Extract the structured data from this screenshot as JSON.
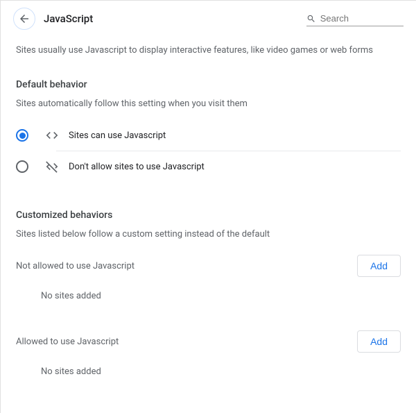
{
  "header": {
    "title": "JavaScript",
    "search_placeholder": "Search"
  },
  "intro": "Sites usually use Javascript to display interactive features, like video games or web forms",
  "default_behavior": {
    "title": "Default behavior",
    "subtext": "Sites automatically follow this setting when you visit them",
    "options": [
      {
        "label": "Sites can use Javascript",
        "selected": true
      },
      {
        "label": "Don't allow sites to use Javascript",
        "selected": false
      }
    ]
  },
  "customized": {
    "title": "Customized behaviors",
    "subtext": "Sites listed below follow a custom setting instead of the default",
    "add_label": "Add",
    "not_allowed": {
      "label": "Not allowed to use Javascript",
      "empty": "No sites added"
    },
    "allowed": {
      "label": "Allowed to use Javascript",
      "empty": "No sites added"
    }
  }
}
